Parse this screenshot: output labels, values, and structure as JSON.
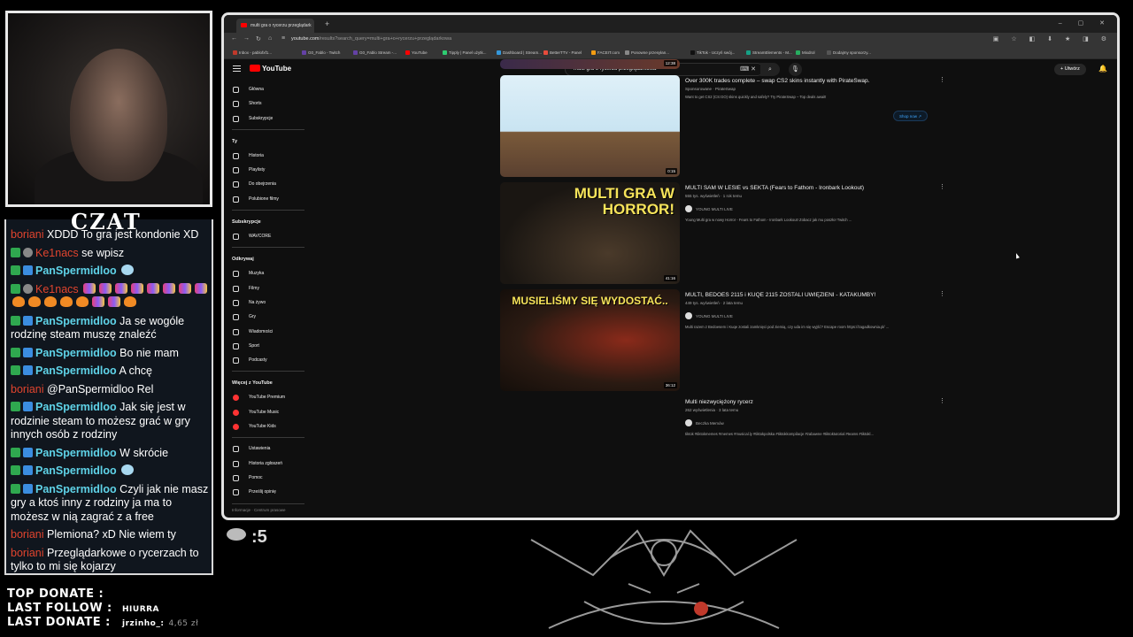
{
  "chat": {
    "title": "CZAT",
    "messages": [
      {
        "user": "boriani",
        "style": "red",
        "badges": [],
        "text": "XDDD To gra jest kondonie XD"
      },
      {
        "user": "Ke1nacs",
        "style": "red",
        "badges": [
          "green",
          "grey"
        ],
        "text": "se wpisz"
      },
      {
        "user": "PanSpermidloo",
        "style": "teal",
        "badges": [
          "green",
          "blue"
        ],
        "text": ""
      },
      {
        "user": "Ke1nacs",
        "style": "red",
        "badges": [
          "green",
          "grey"
        ],
        "text": ""
      },
      {
        "user": "PanSpermidloo",
        "style": "teal",
        "badges": [
          "green",
          "blue"
        ],
        "text": "Ja se wogóle rodzinę steam muszę znaleźć"
      },
      {
        "user": "PanSpermidloo",
        "style": "teal",
        "badges": [
          "green",
          "blue"
        ],
        "text": "Bo nie mam"
      },
      {
        "user": "PanSpermidloo",
        "style": "teal",
        "badges": [
          "green",
          "blue"
        ],
        "text": "A chcę"
      },
      {
        "user": "boriani",
        "style": "red",
        "badges": [],
        "text": "@PanSpermidloo Rel"
      },
      {
        "user": "PanSpermidloo",
        "style": "teal",
        "badges": [
          "green",
          "blue"
        ],
        "text": "Jak się jest w rodzinie steam to możesz grać w gry innych osób z rodziny"
      },
      {
        "user": "PanSpermidloo",
        "style": "teal",
        "badges": [
          "green",
          "blue"
        ],
        "text": "W skrócie"
      },
      {
        "user": "PanSpermidloo",
        "style": "teal",
        "badges": [
          "green",
          "blue"
        ],
        "text": ""
      },
      {
        "user": "PanSpermidloo",
        "style": "teal",
        "badges": [
          "green",
          "blue"
        ],
        "text": "Czyli jak nie masz gry a ktoś inny z rodziny ja ma to możesz w nią zagrać z a free"
      },
      {
        "user": "boriani",
        "style": "red",
        "badges": [],
        "text": "Plemiona? xD Nie wiem ty"
      },
      {
        "user": "boriani",
        "style": "red",
        "badges": [],
        "text": "Przeglądarkowe o rycerzach to tylko to mi się kojarzy"
      }
    ]
  },
  "stats": {
    "top_donate_label": "TOP DONATE :",
    "last_follow_label": "LAST FOLLOW :",
    "last_follow_value": "HIURRA",
    "last_donate_label": "LAST DONATE :",
    "last_donate_user": "jrzinho_:",
    "last_donate_amount": "4,65 zł"
  },
  "viewers": {
    "count": "5"
  },
  "browser": {
    "tab_title": "multi gra o rycerzu przeglądark",
    "url_host": "youtube.com",
    "url_path": "/results?search_query=multi+gra+o+rycerzu+przeglądarkowa",
    "bookmarks": [
      "Inbox - pablofxf1...",
      "G0_Fablo - Twitch",
      "G0_Fablo Stream -...",
      "YouTube",
      "Tipply | Panel użytk...",
      "Dashboard | Stream...",
      "BetterTTV - Panel",
      "FACEIT.com",
      "Ponowne przesyłan...",
      "TikTok - Uczyń swój...",
      "StreamElements - M...",
      "Mixdrol",
      "Dodajmy sponsorzy..."
    ]
  },
  "youtube": {
    "logo": "YouTube",
    "search_value": "multi gra o rycerzu przeglądarkowa",
    "create_label": "Utwórz",
    "sidebar": {
      "main": [
        "Główna",
        "Shorts",
        "Subskrypcje"
      ],
      "you_header": "Ty",
      "you": [
        "Historia",
        "Playlisty",
        "Do obejrzenia",
        "Polubione filmy"
      ],
      "subs_header": "Subskrypcje",
      "subs": [
        "WAVCORE"
      ],
      "explore_header": "Odkrywaj",
      "explore": [
        "Muzyka",
        "Filmy",
        "Na żywo",
        "Gry",
        "Wiadomości",
        "Sport",
        "Podcasty"
      ],
      "more_header": "Więcej z YouTube",
      "more": [
        "YouTube Premium",
        "YouTube Music",
        "YouTube Kids"
      ],
      "settings": [
        "Ustawienia",
        "Historia zgłoszeń",
        "Pomoc",
        "Prześlij opinię"
      ],
      "footer": "Informacje · Centrum prasowe"
    },
    "top_duration": "12:38",
    "results": [
      {
        "title": "Over 300K trades complete – swap CS2 skins instantly with PirateSwap.",
        "meta": "Sponsorowane · PirateSwap",
        "channel": "",
        "desc": "Want to get CS2 (CS:GO) skins quickly and safely? Try PirateSwap – Top deals await!",
        "duration": "0:15",
        "cta": "Shop now"
      },
      {
        "title": "MULTI SAM W LESIE vs SEKTA (Fears to Fathom - Ironbark Lookout)",
        "meta": "555 tys. wyświetleń · 1 rok temu",
        "channel": "YOUNG MULTI LIVE",
        "desc": "Young Multi gra w nowy Horror - Fears to Fathom - Ironbark Lookout! Zobacz jak mu poszło! Twitch ...",
        "duration": "41:16",
        "thumb_text": "MULTI GRA W HORROR!"
      },
      {
        "title": "MULTI, BEDOES 2115 i KUQE 2115 ZOSTALI UWIĘZIENI - KATAKUMBY!",
        "meta": "449 tys. wyświetleń · 2 lata temu",
        "channel": "YOUNG MULTI LIVE",
        "desc": "Multi razem z Bedoesem i Kuqe zostali zamknięci pod ziemią, czy uda im się wyjść? Escape room https://zagadkownia.pl/ ...",
        "duration": "36:12",
        "thumb_text": "MUSIELIŚMY SIĘ WYDOSTAĆ.."
      },
      {
        "title": "Multi niezwyciężony rycerz",
        "meta": "262 wyświetlenia · 3 lata temu",
        "channel": "Beczka Memów",
        "desc": "tiktok #tiktokmemes #memes #musical.ly #tiktokpolska #tiktokkompilacje #zabawne #tiktoktutorial #teams #tiktokl..."
      }
    ]
  },
  "colors": {
    "accent_red": "#ff0000",
    "chat_teal": "#5fd3e8",
    "chat_red": "#e0442e",
    "link_blue": "#3ea6ff"
  }
}
